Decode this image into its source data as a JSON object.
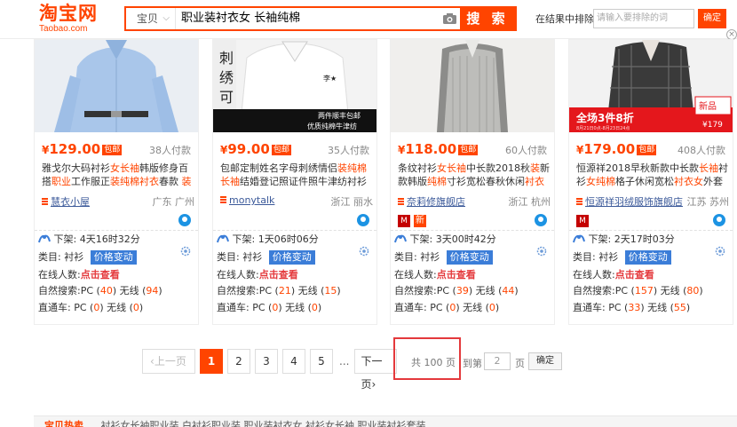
{
  "header": {
    "logo_cn": "淘宝网",
    "logo_en": "Taobao.com",
    "search_type": "宝贝",
    "search_query": "职业装衬衣女 长袖纯棉",
    "search_button": "搜 索",
    "within_label": "在结果中排除",
    "within_placeholder": "请输入要排除的词",
    "within_button": "确定",
    "accent": "#ff4400"
  },
  "products": [
    {
      "price": "129.00",
      "baoyou": "包邮",
      "paid": "38人付款",
      "title_parts": [
        {
          "t": "雅戈尔大码衬衫",
          "h": false
        },
        {
          "t": "女长袖",
          "h": true
        },
        {
          "t": "韩版修身百搭",
          "h": false
        },
        {
          "t": "职业",
          "h": true
        },
        {
          "t": "工作服正",
          "h": false
        },
        {
          "t": "装纯棉衬衣",
          "h": true
        },
        {
          "t": "春款 ",
          "h": false
        },
        {
          "t": "装",
          "h": true
        }
      ],
      "shop": "慧衣小屋",
      "location": "广东 广州",
      "tmall": false,
      "new": false,
      "offline_label": "下架:",
      "offline_time": "4天16时32分",
      "category_label": "类目:",
      "category": "衬衫",
      "price_change": "价格变动",
      "online_label": "在线人数:",
      "online_value": "点击查看",
      "natural_label": "自然搜索:",
      "natural_pc": "40",
      "natural_wireless": "94",
      "direct_label": "直通车:",
      "direct_pc": "0",
      "direct_wireless": "0"
    },
    {
      "price": "99.00",
      "baoyou": "包邮",
      "paid": "35人付款",
      "title_parts": [
        {
          "t": "包邮定制姓名字母刺绣情侣",
          "h": false
        },
        {
          "t": "装纯棉长袖",
          "h": true
        },
        {
          "t": "结婚登记照证件照牛津纺衬衫",
          "h": false
        }
      ],
      "shop": "monytalk",
      "location": "浙江 丽水",
      "tmall": false,
      "new": false,
      "offline_label": "下架:",
      "offline_time": "1天06时06分",
      "category_label": "类目:",
      "category": "衬衫",
      "price_change": "价格变动",
      "online_label": "在线人数:",
      "online_value": "点击查看",
      "natural_label": "自然搜索:",
      "natural_pc": "21",
      "natural_wireless": "15",
      "direct_label": "直通车:",
      "direct_pc": "0",
      "direct_wireless": "0"
    },
    {
      "price": "118.00",
      "baoyou": "包邮",
      "paid": "60人付款",
      "title_parts": [
        {
          "t": "条纹衬衫",
          "h": false
        },
        {
          "t": "女长袖",
          "h": true
        },
        {
          "t": "中长款2018秋",
          "h": false
        },
        {
          "t": "装",
          "h": true
        },
        {
          "t": "新款韩版",
          "h": false
        },
        {
          "t": "纯棉",
          "h": true
        },
        {
          "t": "寸衫宽松春秋休闲",
          "h": false
        },
        {
          "t": "衬衣",
          "h": true
        }
      ],
      "shop": "奈莉修旗舰店",
      "location": "浙江 杭州",
      "tmall": true,
      "new": true,
      "new_label": "新",
      "offline_label": "下架:",
      "offline_time": "3天00时42分",
      "category_label": "类目:",
      "category": "衬衫",
      "price_change": "价格变动",
      "online_label": "在线人数:",
      "online_value": "点击查看",
      "natural_label": "自然搜索:",
      "natural_pc": "39",
      "natural_wireless": "44",
      "direct_label": "直通车:",
      "direct_pc": "0",
      "direct_wireless": "0"
    },
    {
      "price": "179.00",
      "baoyou": "包邮",
      "paid": "408人付款",
      "title_parts": [
        {
          "t": "恒源祥2018早秋新款中长款",
          "h": false
        },
        {
          "t": "长袖",
          "h": true
        },
        {
          "t": "衬衫",
          "h": false
        },
        {
          "t": "女纯棉",
          "h": true
        },
        {
          "t": "格子休闲宽松",
          "h": false
        },
        {
          "t": "衬衣女",
          "h": true
        },
        {
          "t": "外套",
          "h": false
        }
      ],
      "shop": "恒源祥羽绒服饰旗舰店",
      "location": "江苏 苏州",
      "tmall": true,
      "new": false,
      "offline_label": "下架:",
      "offline_time": "2天17时03分",
      "category_label": "类目:",
      "category": "衬衫",
      "price_change": "价格变动",
      "online_label": "在线人数:",
      "online_value": "点击查看",
      "natural_label": "自然搜索:",
      "natural_pc": "157",
      "natural_wireless": "80",
      "direct_label": "直通车:",
      "direct_pc": "33",
      "direct_wireless": "55"
    }
  ],
  "image_texts": {
    "p2_calligraphy": "刺绣可定製",
    "p2_caption1": "两件顺丰包邮",
    "p2_caption2": "优质纯棉牛津纺",
    "p4_promo": "全场3件8折",
    "p4_promo_date": "8月21日0点-8月23日24点",
    "p4_new": "新品",
    "p4_price": "¥179"
  },
  "pagination": {
    "prev": "上一页",
    "pages": [
      "1",
      "2",
      "3",
      "4",
      "5"
    ],
    "current": "1",
    "ellipsis": "...",
    "next": "下一页",
    "total": "共 100 页",
    "goto_label": "到第",
    "goto_value": "2",
    "page_label": "页",
    "confirm": "确定"
  },
  "bottom": {
    "related_label": "宝贝热卖",
    "links": "衬衫女长袖职业装   白衬衫职业装   职业装衬衣女   衬衫女长袖   职业装衬衫套装"
  }
}
